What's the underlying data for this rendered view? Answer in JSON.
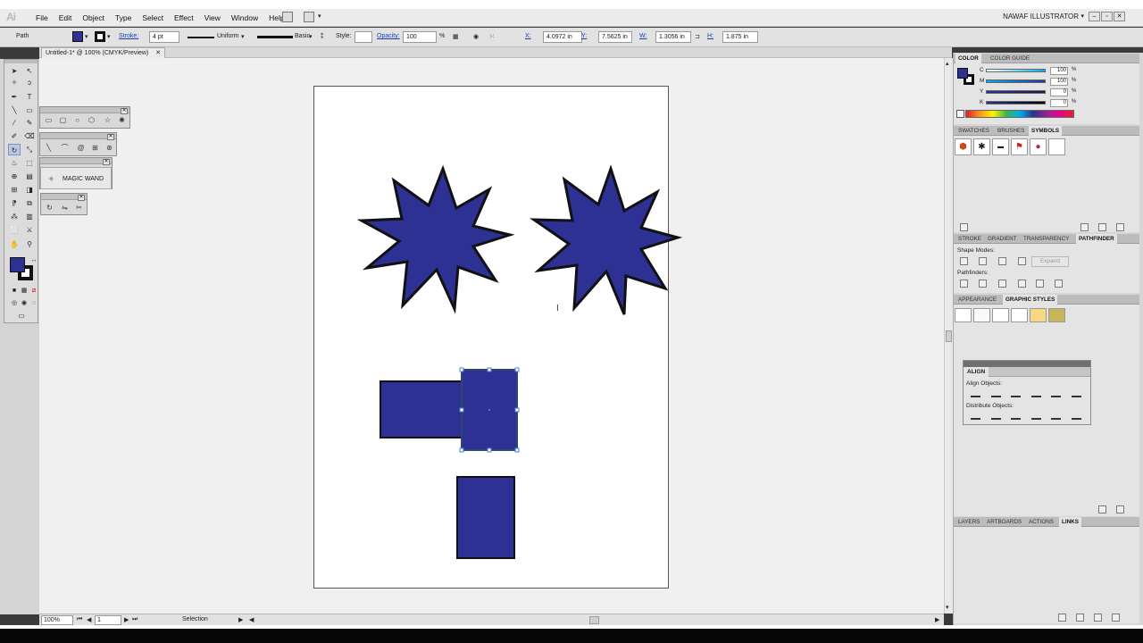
{
  "app": {
    "logo": "Ai",
    "workspace": "NAWAF ILLUSTRATOR"
  },
  "menu": [
    "File",
    "Edit",
    "Object",
    "Type",
    "Select",
    "Effect",
    "View",
    "Window",
    "Help"
  ],
  "control": {
    "selection_type": "Path",
    "stroke_label": "Stroke:",
    "stroke_weight": "4 pt",
    "profile": "Uniform",
    "brush": "Basic",
    "style_label": "Style:",
    "opacity_label": "Opacity:",
    "opacity_value": "100",
    "opacity_unit": "%",
    "x_label": "X:",
    "x_value": "4.0972 in",
    "y_label": "Y:",
    "y_value": "7.5625 in",
    "w_label": "W:",
    "w_value": "1.3056 in",
    "h_label": "H:",
    "h_value": "1.875 in"
  },
  "document": {
    "tab_title": "Untitled-1* @ 100% (CMYK/Preview)"
  },
  "tools": {
    "magic_wand_label": "MAGIC WAND",
    "fill_color": "#2c3193",
    "stroke_color": "#111111"
  },
  "status": {
    "zoom": "100%",
    "page": "1",
    "tool": "Selection"
  },
  "artwork": {
    "shape_fill": "#2c3193",
    "stroke": "#111111"
  },
  "panels": {
    "color": {
      "tabs": [
        "COLOR",
        "COLOR GUIDE"
      ],
      "channels": [
        {
          "label": "C",
          "value": "100"
        },
        {
          "label": "M",
          "value": "100"
        },
        {
          "label": "Y",
          "value": "0"
        },
        {
          "label": "K",
          "value": "0"
        }
      ],
      "percent": "%"
    },
    "swatches": {
      "tabs": [
        "SWATCHES",
        "BRUSHES",
        "SYMBOLS"
      ]
    },
    "pathfinder": {
      "tabs": [
        "STROKE",
        "GRADIENT",
        "TRANSPARENCY",
        "PATHFINDER"
      ],
      "shape_modes_label": "Shape Modes:",
      "pathfinders_label": "Pathfinders:",
      "expand_label": "Expand"
    },
    "appearance": {
      "tabs": [
        "APPEARANCE",
        "GRAPHIC STYLES"
      ]
    },
    "align": {
      "tab": "ALIGN",
      "align_objects_label": "Align Objects:",
      "distribute_objects_label": "Distribute Objects:"
    },
    "layers": {
      "tabs": [
        "LAYERS",
        "ARTBOARDS",
        "ACTIONS",
        "LINKS"
      ]
    }
  }
}
